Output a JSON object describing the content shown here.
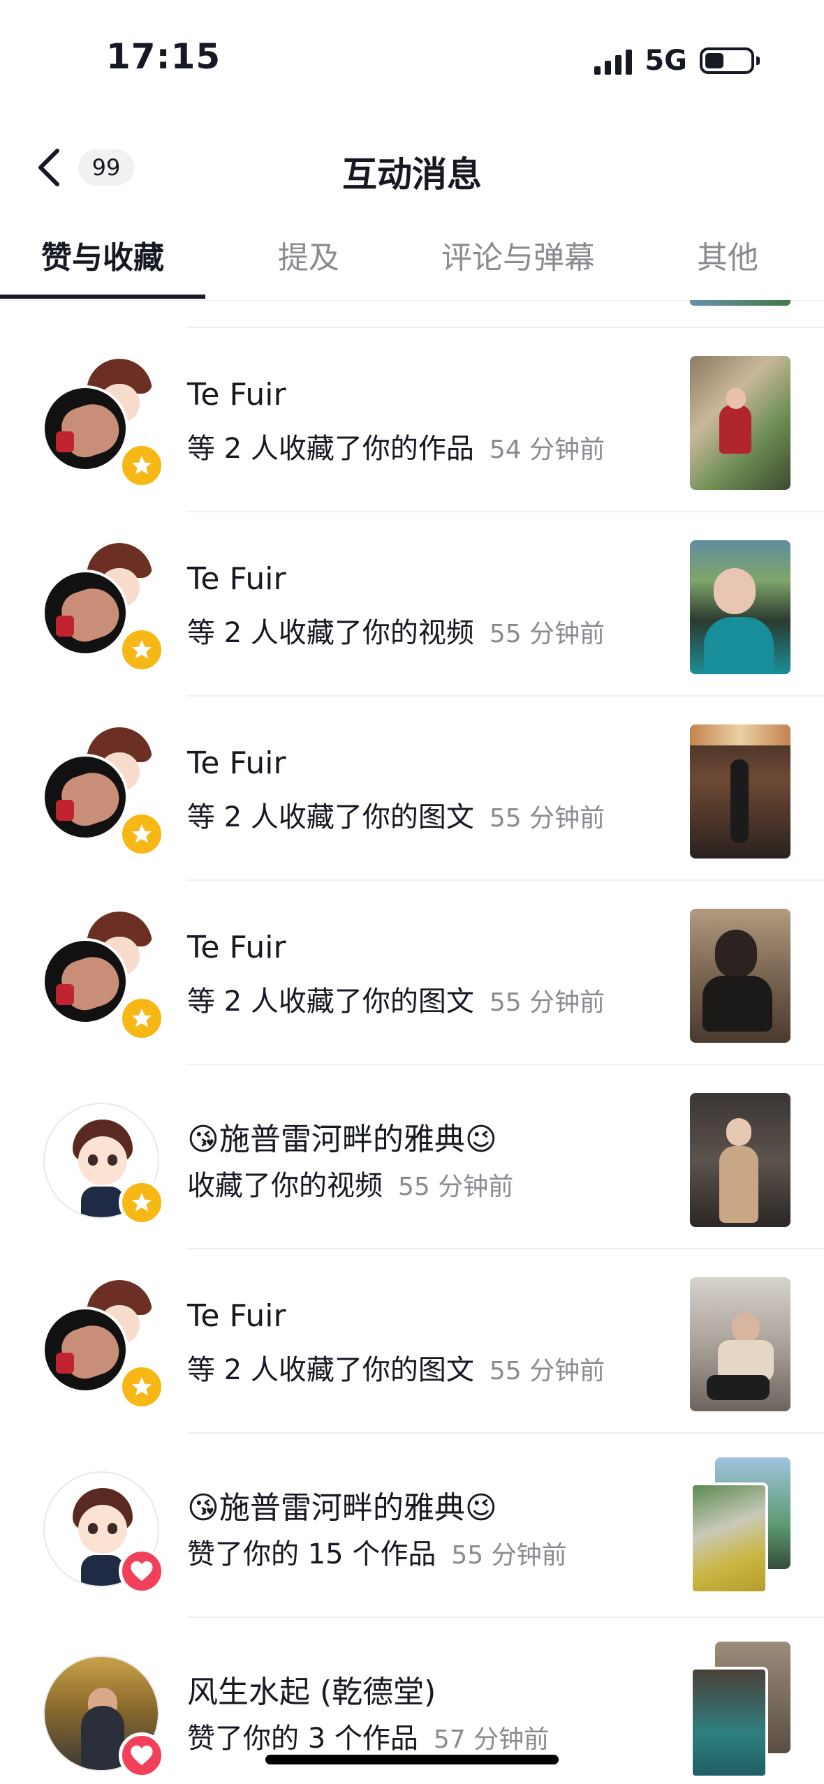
{
  "status": {
    "time": "17:15",
    "network": "5G"
  },
  "header": {
    "title": "互动消息",
    "unread_count": "99"
  },
  "tabs": [
    {
      "label": "赞与收藏",
      "active": true
    },
    {
      "label": "提及",
      "active": false
    },
    {
      "label": "评论与弹幕",
      "active": false
    },
    {
      "label": "其他",
      "active": false
    }
  ],
  "items": [
    {
      "name": "Te  Fuir",
      "action": "等 2 人收藏了你的作品",
      "time": "54 分钟前",
      "badge": "star-icon"
    },
    {
      "name": "Te  Fuir",
      "action": "等 2 人收藏了你的视频",
      "time": "55 分钟前",
      "badge": "star-icon"
    },
    {
      "name": "Te  Fuir",
      "action": "等 2 人收藏了你的图文",
      "time": "55 分钟前",
      "badge": "star-icon"
    },
    {
      "name": "Te  Fuir",
      "action": "等 2 人收藏了你的图文",
      "time": "55 分钟前",
      "badge": "star-icon"
    },
    {
      "name": "😘施普雷河畔的雅典😉",
      "action": "收藏了你的视频",
      "time": "55 分钟前",
      "badge": "star-icon"
    },
    {
      "name": "Te  Fuir",
      "action": "等 2 人收藏了你的图文",
      "time": "55 分钟前",
      "badge": "star-icon"
    },
    {
      "name": "😘施普雷河畔的雅典😉",
      "action": "赞了你的 15 个作品",
      "time": "55 分钟前",
      "badge": "heart-icon"
    },
    {
      "name": "风生水起 (乾德堂)",
      "action": "赞了你的 3 个作品",
      "time": "57 分钟前",
      "badge": "heart-icon"
    }
  ],
  "colors": {
    "star_badge": "#f7b715",
    "heart_badge": "#f2405a",
    "secondary_text": "#8a8b91"
  }
}
